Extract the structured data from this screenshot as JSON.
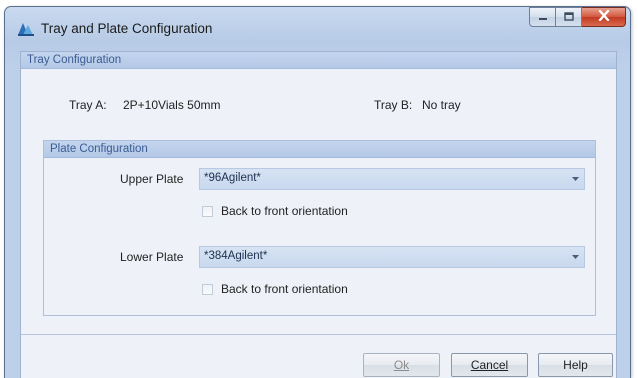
{
  "window": {
    "title": "Tray and Plate Configuration",
    "close_color": "#c84a33",
    "accent": "#b7cbe6"
  },
  "tray_configuration": {
    "header": "Tray Configuration",
    "tray_a_label": "Tray A:",
    "tray_a_value": "2P+10Vials 50mm",
    "tray_b_label": "Tray B:",
    "tray_b_value": "No tray"
  },
  "plate_configuration": {
    "header": "Plate Configuration",
    "upper_plate": {
      "label": "Upper Plate",
      "value": "*96Agilent*",
      "checkbox_label": "Back to front orientation",
      "checked": false
    },
    "lower_plate": {
      "label": "Lower Plate",
      "value": "*384Agilent*",
      "checkbox_label": "Back to front orientation",
      "checked": false
    }
  },
  "buttons": {
    "ok": "Ok",
    "cancel": "Cancel",
    "help": "Help"
  },
  "icons": {
    "app": "tray-plate-app-icon",
    "minimize": "minimize-icon",
    "maximize": "maximize-icon",
    "close": "close-icon",
    "dropdown": "chevron-down-icon"
  }
}
